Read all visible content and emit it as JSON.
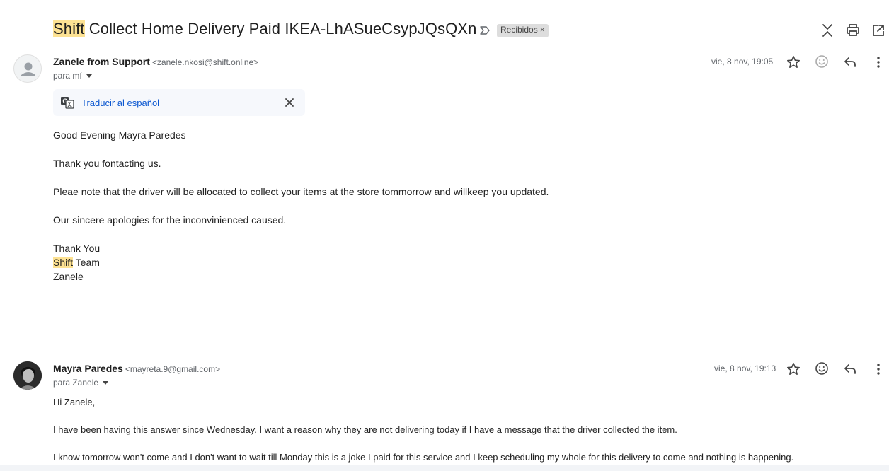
{
  "subject": {
    "highlight": "Shift",
    "rest": " Collect Home Delivery Paid IKEA-LhASueCsypJQsQXn",
    "label_chip": "Recibidos",
    "label_chip_close": "×"
  },
  "top_icons": [
    "label-arrow-icon",
    "collapse-all-icon",
    "print-icon",
    "open-in-new-window-icon"
  ],
  "messages": [
    {
      "sender_name": "Zanele from Support",
      "sender_email": "<zanele.nkosi@shift.online>",
      "to": "para mí",
      "date": "vie, 8 nov, 19:05",
      "translate_label": "Traducir al español",
      "body": [
        "Good Evening Mayra Paredes",
        "Thank you fontacting us.",
        "Pleae note that the driver will be allocated to collect your items at the store tommorrow and willkeep you updated.",
        "Our sincere apologies for the inconvinienced caused.",
        "Thank You"
      ],
      "signature_highlight": "Shift",
      "signature_team": " Team",
      "signature_name": "Zanele"
    },
    {
      "sender_name": "Mayra Paredes",
      "sender_email": "<mayreta.9@gmail.com>",
      "to": "para Zanele",
      "date": "vie, 8 nov, 19:13",
      "body": [
        "Hi Zanele,",
        "I have been having this answer since Wednesday. I want a reason why they are not delivering today if I have a message that the driver collected the item.",
        "I know tomorrow won't come and I don't want to wait till Monday this is a joke I paid for this service and I keep scheduling my whole for this delivery to come and nothing is happening."
      ]
    }
  ],
  "colors": {
    "highlight": "#fde293",
    "link": "#0b57d0",
    "chip_bg": "#dddddd"
  }
}
